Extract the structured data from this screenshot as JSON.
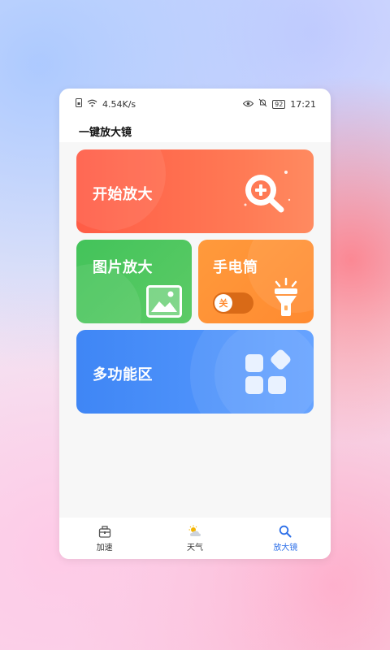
{
  "status_bar": {
    "network_speed": "4.54K/s",
    "battery": "92",
    "time": "17:21"
  },
  "app": {
    "title": "一键放大镜"
  },
  "cards": {
    "start_magnify": "开始放大",
    "image_magnify": "图片放大",
    "flashlight": "手电筒",
    "flashlight_toggle": "关",
    "multi_function": "多功能区"
  },
  "tabs": [
    {
      "label": "加速",
      "icon": "speed-icon",
      "active": false
    },
    {
      "label": "天气",
      "icon": "weather-icon",
      "active": false
    },
    {
      "label": "放大镜",
      "icon": "magnifier-icon",
      "active": true
    }
  ],
  "colors": {
    "start_card": "#ff5c46",
    "image_card": "#43c35a",
    "torch_card": "#ff9a3c",
    "multi_card": "#3f86f5",
    "active_tab": "#2b6ee8"
  }
}
